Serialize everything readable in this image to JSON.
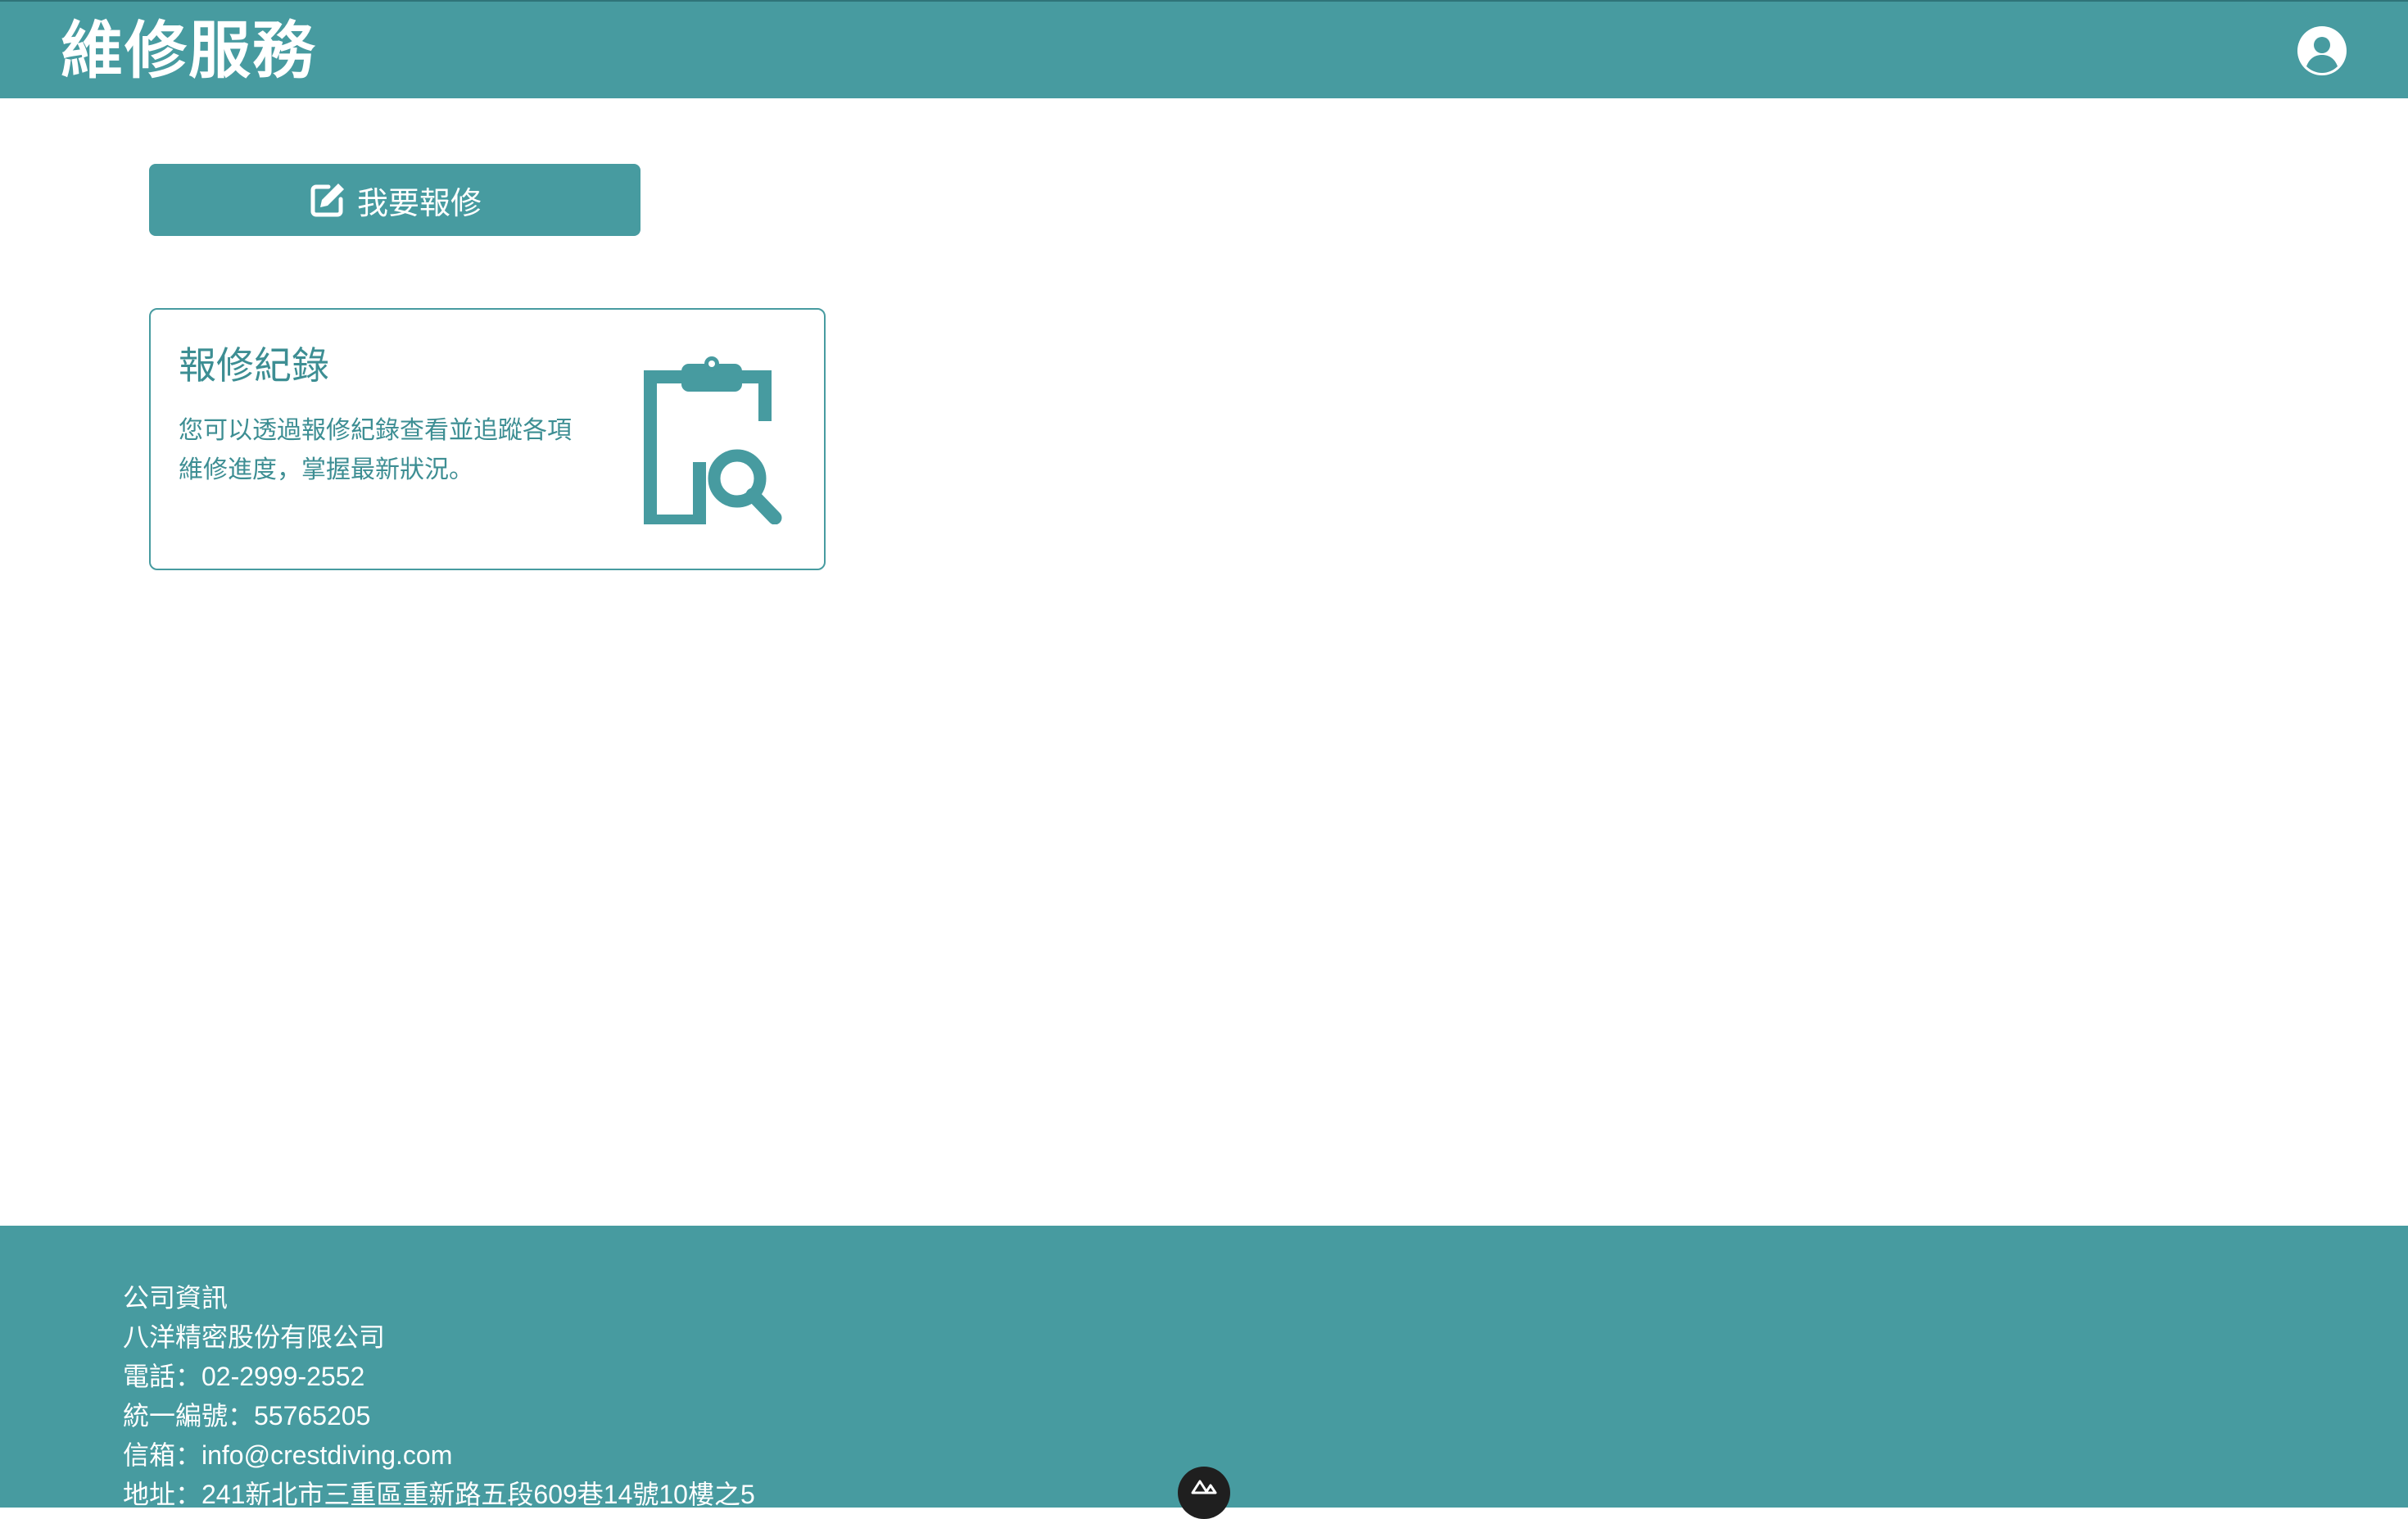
{
  "header": {
    "title": "維修服務",
    "account_icon": "user-circle-icon"
  },
  "actions": {
    "report_repair_label": "我要報修",
    "report_repair_icon": "edit-square-icon"
  },
  "records_card": {
    "title": "報修紀錄",
    "description": "您可以透過報修紀錄查看並追蹤各項維修進度，掌握最新狀況。",
    "icon": "clipboard-search-icon"
  },
  "footer": {
    "heading": "公司資訊",
    "company": "八洋精密股份有限公司",
    "phone": "電話：02-2999-2552",
    "tax_id": "統一編號：55765205",
    "email": "信箱：info@crestdiving.com",
    "address": "地址：241新北市三重區重新路五段609巷14號10樓之5"
  },
  "devtools": {
    "icon": "nuxt-logo-icon"
  },
  "colors": {
    "primary": "#479ba0",
    "card_text": "#3d8e93",
    "background": "#ffffff",
    "on_primary": "#ffffff",
    "badge": "#1f1f1f"
  }
}
